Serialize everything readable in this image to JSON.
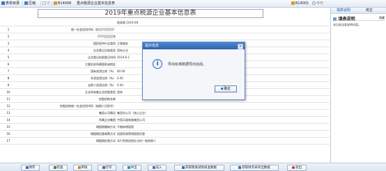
{
  "toolbar": {
    "items": [
      {
        "label": "表单目录"
      },
      {
        "label": "压缩"
      },
      {
        "label": "无"
      },
      {
        "label": "B14008"
      },
      {
        "label": "重点税源企业基本信息表"
      }
    ],
    "right_code": "B14001",
    "right_text": "许可"
  },
  "side": {
    "tabs": [
      "填表说明",
      "校正"
    ],
    "panel_title": "填表说明",
    "hide_label": "隐藏",
    "text": "本比较法表说明内容。"
  },
  "form": {
    "title": "2019年重点税源企业基本信息表",
    "rows": [
      {
        "num": "",
        "label": "",
        "value": "报表期 2019-08"
      },
      {
        "num": "1",
        "label": "统一社会信用代码（纳税人识别号）",
        "value": ""
      },
      {
        "num": "2",
        "label": "企业名称",
        "value": ""
      },
      {
        "num": "3",
        "label": "国民经济行业类别",
        "value": "正餐服务"
      },
      {
        "num": "4",
        "label": "企业登记注册类型",
        "value": "国有企业"
      },
      {
        "num": "5",
        "label": "企业登记执照登记时间",
        "value": "2019-6-1"
      },
      {
        "num": "6",
        "label": "主要机关所属国家或地区",
        "value": ""
      },
      {
        "num": "7",
        "label": "国有投资比例（%）",
        "value": "60.00"
      },
      {
        "num": "8",
        "label": "外资投资比例（%）",
        "value": "0.00"
      },
      {
        "num": "9",
        "label": "自然人投资比例（%）",
        "value": "0.00"
      },
      {
        "num": "10",
        "label": "企业所有制企业控股类型",
        "value": "国有"
      },
      {
        "num": "11",
        "label": "控股机构名称",
        "value": ""
      },
      {
        "num": "12",
        "label": "控股机构统一社会信用代码（纳税人识别号）",
        "value": ""
      },
      {
        "num": "13",
        "label": "集团公司情况",
        "value": "集团母公司（核心企业）"
      },
      {
        "num": "14",
        "label": "所属企业集团",
        "value": "中国兵器装备集团公司"
      },
      {
        "num": "15",
        "label": "增值税缴纳方式",
        "value": "不缴纳增值税"
      },
      {
        "num": "16",
        "label": "增值税优惠政策方式",
        "value": "因国家政策增值税优惠"
      },
      {
        "num": "17",
        "label": "增值税征税方式",
        "value": "实行免税退税办法的一般纳税人"
      }
    ]
  },
  "dialog": {
    "title": "提示信息",
    "close": "×",
    "icon": "i",
    "message": "导出标准数据导出完成。",
    "ok_label": "确定"
  },
  "bottom_buttons": [
    {
      "label": "保存"
    },
    {
      "label": "检查"
    },
    {
      "label": "审核"
    },
    {
      "label": "打印"
    },
    {
      "label": "导出"
    },
    {
      "label": "读入"
    },
    {
      "label": "获取税收减免核准数据"
    },
    {
      "label": "获取财务表导出数据"
    },
    {
      "label": "退出"
    }
  ],
  "colors": {
    "accent": "#2e63b3",
    "border": "#b9c9de",
    "title_bar": "#4d86cf"
  }
}
